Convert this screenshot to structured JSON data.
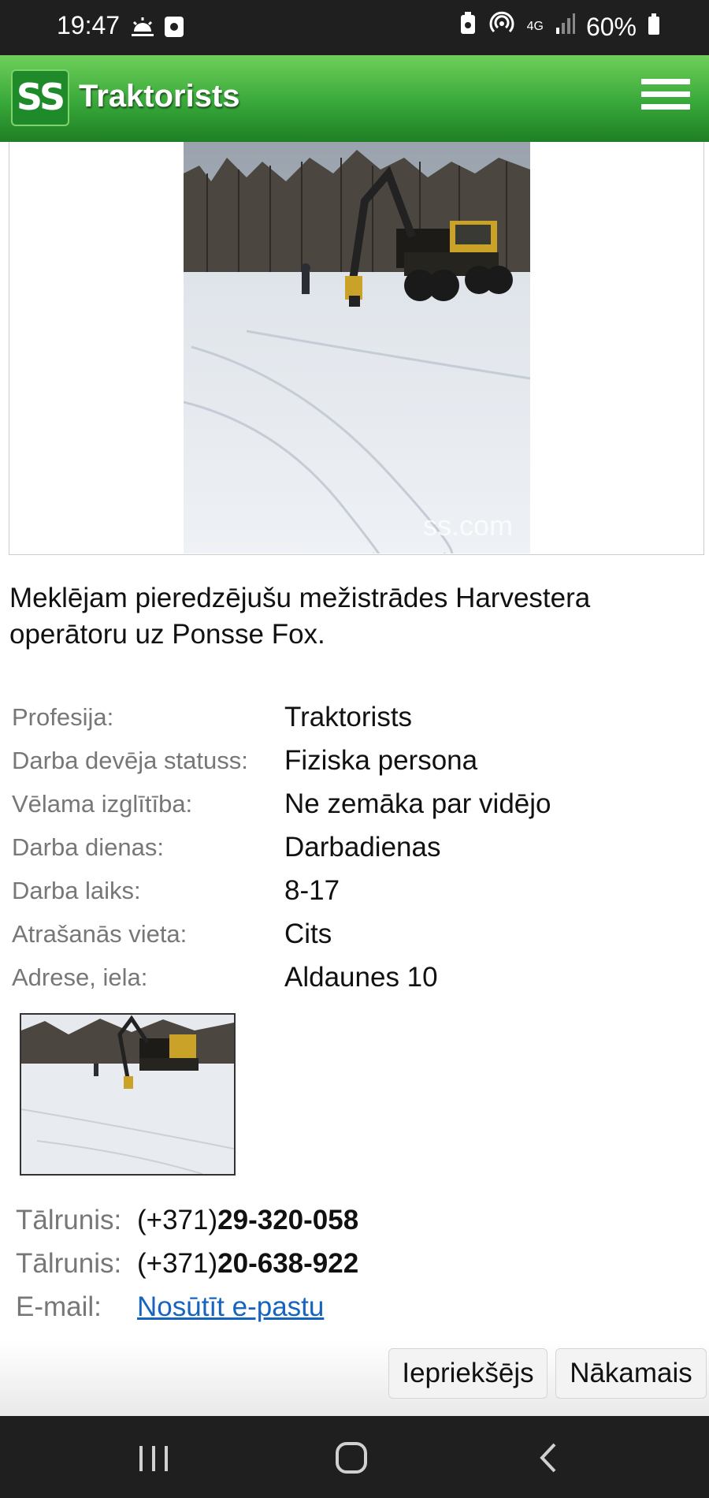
{
  "status_bar": {
    "time": "19:47",
    "battery": "60%",
    "network": "4G"
  },
  "app_bar": {
    "logo_text": "SS",
    "title": "Traktorists"
  },
  "photo": {
    "watermark": "ss.com"
  },
  "description": "Meklējam pieredzējušu mežistrādes Harvestera operātoru uz Ponsse Fox.",
  "details": [
    {
      "label": "Profesija:",
      "value": "Traktorists"
    },
    {
      "label": "Darba devēja statuss:",
      "value": "Fiziska persona"
    },
    {
      "label": "Vēlama izglītība:",
      "value": "Ne zemāka par vidējo"
    },
    {
      "label": "Darba dienas:",
      "value": "Darbadienas"
    },
    {
      "label": "Darba laiks:",
      "value": "8-17"
    },
    {
      "label": "Atrašanās vieta:",
      "value": "Cits"
    },
    {
      "label": "Adrese, iela:",
      "value": "Aldaunes 10"
    }
  ],
  "contacts": {
    "phone1": {
      "label": "Tālrunis:",
      "prefix": "(+371)",
      "number": "29-320-058"
    },
    "phone2": {
      "label": "Tālrunis:",
      "prefix": "(+371)",
      "number": "20-638-922"
    },
    "email": {
      "label": "E-mail:",
      "link": "Nosūtīt e-pastu"
    }
  },
  "navigation": {
    "prev_label": "Iepriekšējs",
    "next_label": "Nākamais"
  },
  "colors": {
    "appbar_green": "#38a83a",
    "link_blue": "#1565c0",
    "status_bar": "#1f1f1f"
  }
}
